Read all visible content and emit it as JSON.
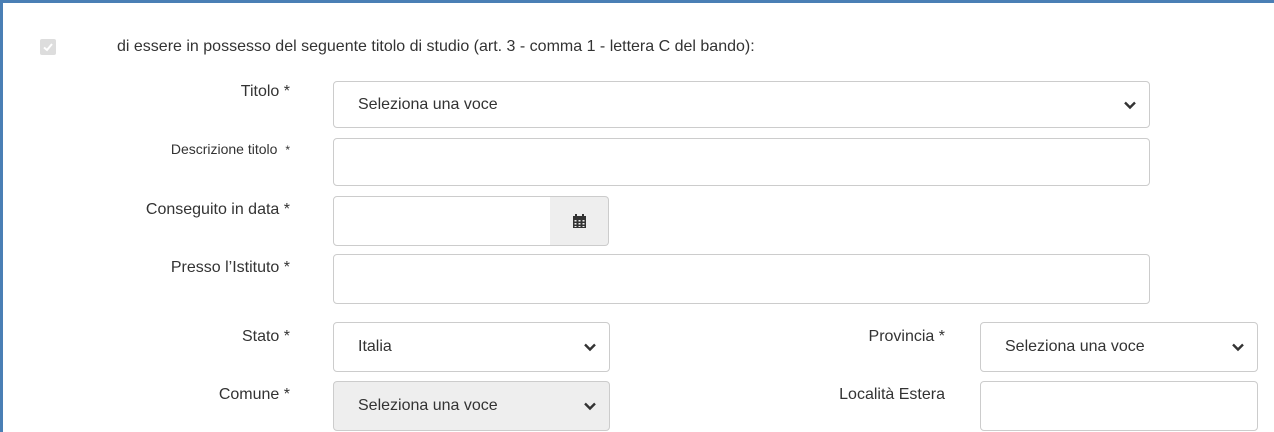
{
  "declaration": {
    "checked": true,
    "text": "di essere in possesso del seguente titolo di studio (art. 3 - comma 1 - lettera C del bando):"
  },
  "form": {
    "titolo": {
      "label": "Titolo *",
      "value": "Seleziona una voce"
    },
    "descrizione": {
      "label": "Descrizione titolo",
      "required_mark": "*",
      "value": ""
    },
    "data": {
      "label": "Conseguito in data *",
      "value": "",
      "icon": "calendar-icon"
    },
    "istituto": {
      "label": "Presso l’Istituto *",
      "value": ""
    },
    "stato": {
      "label": "Stato *",
      "value": "Italia"
    },
    "provincia": {
      "label": "Provincia *",
      "value": "Seleziona una voce"
    },
    "comune": {
      "label": "Comune *",
      "value": "Seleziona una voce"
    },
    "localita": {
      "label": "Località Estera",
      "value": ""
    }
  },
  "colors": {
    "frame_border": "#4a7fb5",
    "input_border": "#cccccc",
    "disabled_bg": "#eeeeee"
  }
}
